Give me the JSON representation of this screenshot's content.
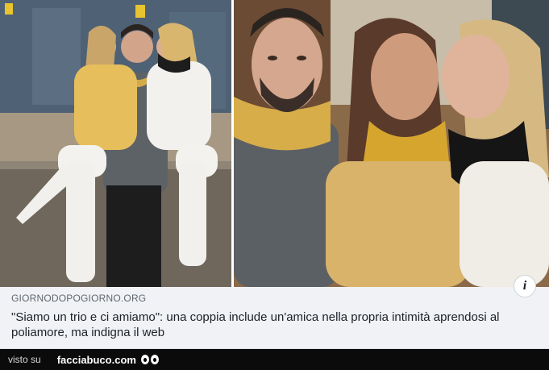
{
  "post": {
    "domain": "GIORNODOPOGIORNO.ORG",
    "headline": "\"Siamo un trio e ci amiamo\": una coppia include un'amica nella propria intimità aprendosi al poliamore, ma indigna il web",
    "info_label": "i"
  },
  "footer": {
    "seen_on": "visto su",
    "brand": "facciabuco.com",
    "brand_icon": "eyes-icon"
  },
  "colors": {
    "card_background": "#f0f2f5",
    "footer_background": "#0b0b0b",
    "domain_text": "#606770",
    "headline_text": "#1d2129"
  }
}
